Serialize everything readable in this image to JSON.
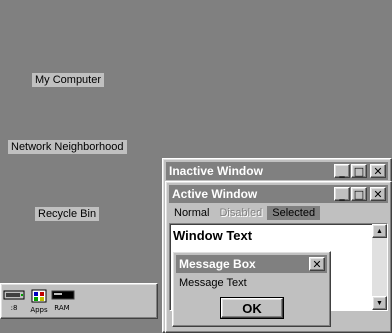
{
  "desktop": {
    "icons": [
      {
        "label": "My Computer"
      },
      {
        "label": "Network Neighborhood"
      },
      {
        "label": "Recycle Bin"
      }
    ]
  },
  "tray": {
    "items": [
      {
        "label": ":8",
        "icon": "drive-icon"
      },
      {
        "label": "Apps",
        "icon": "apps-icon"
      },
      {
        "label": "RAM",
        "icon": "ram-icon"
      }
    ]
  },
  "inactive_window": {
    "title": "Inactive Window",
    "minimize": "_",
    "maximize": "□",
    "close": "✕"
  },
  "active_window": {
    "title": "Active Window",
    "minimize": "_",
    "maximize": "□",
    "close": "✕",
    "menu": {
      "normal": "Normal",
      "disabled": "Disabled",
      "selected": "Selected"
    },
    "content_text": "Window Text",
    "scroll_up": "▲",
    "scroll_down": "▼"
  },
  "message_box": {
    "title": "Message Box",
    "close": "✕",
    "text": "Message Text",
    "ok_label": "OK"
  },
  "colors": {
    "desktop": "#808080",
    "face": "#c0c0c0",
    "active_title": "#808080",
    "inactive_title": "#808080",
    "selected_menu": "#808080"
  }
}
